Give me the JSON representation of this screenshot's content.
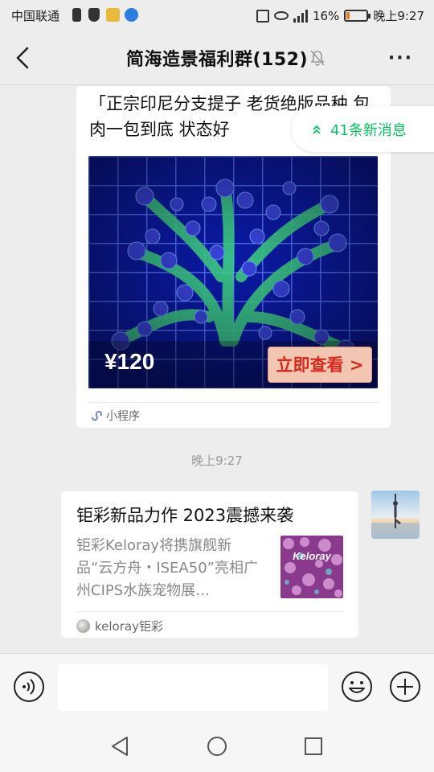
{
  "status_bar": {
    "carrier": "中国联通",
    "battery_percent": "16%",
    "time": "晚上9:27",
    "battery_level": 0.16
  },
  "header": {
    "title": "简海造景福利群(152)",
    "icons": [
      "back-arrow-icon",
      "mute-bell-icon",
      "more-dots-icon"
    ],
    "more_label": "···"
  },
  "messages": {
    "card1": {
      "text": "「正宗印尼分支提子 老货绝版品种 包肉一包到底 状态好",
      "price": "¥120",
      "button": "立即查看 >",
      "footer": "小程序"
    },
    "new_messages": "41条新消息",
    "timestamp": "晚上9:27",
    "card2": {
      "title": "钜彩新品力作 2023震撼来袭",
      "description": "钜彩Keloray将携旗舰新品“云方舟・ISEA50”亮相广州CIPS水族宠物展…",
      "thumb_text": "Keloray",
      "source": "keloray钜彩"
    }
  },
  "input_bar": {
    "icons": [
      "voice-icon",
      "emoji-icon",
      "plus-icon"
    ]
  },
  "nav_bar": {
    "icons": [
      "nav-back-icon",
      "nav-home-icon",
      "nav-recents-icon"
    ]
  },
  "colors": {
    "accent_green": "#07c160",
    "price_button_red": "#d42a1e",
    "background": "#ededed"
  }
}
